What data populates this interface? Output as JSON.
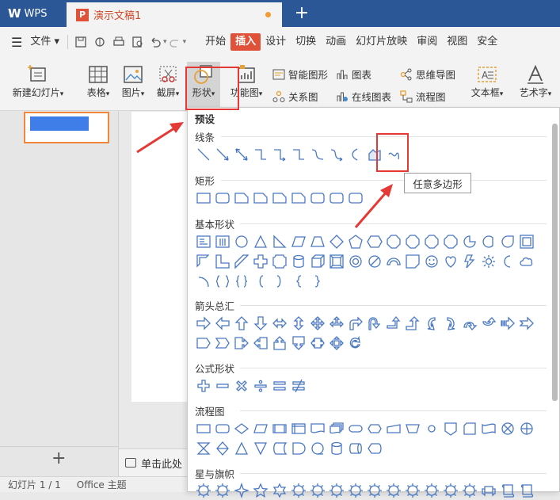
{
  "titlebar": {
    "app_name": "WPS",
    "doc_name": "演示文稿1",
    "new_tab": "+"
  },
  "menu": {
    "file": "文件",
    "items": [
      "开始",
      "插入",
      "设计",
      "切换",
      "动画",
      "幻灯片放映",
      "审阅",
      "视图",
      "安全"
    ],
    "active": "插入"
  },
  "ribbon": {
    "new_slide": "新建幻灯片",
    "table": "表格",
    "picture": "图片",
    "screenshot": "截屏",
    "shapes": "形状",
    "function_chart": "功能图",
    "smart_art": "智能图形",
    "chart": "图表",
    "mind_map": "思维导图",
    "relation": "关系图",
    "online_chart": "在线图表",
    "flowchart": "流程图",
    "textbox": "文本框",
    "wordart": "艺术字"
  },
  "dropdown": {
    "preset": "预设",
    "sections": {
      "lines": "线条",
      "rect": "矩形",
      "basic": "基本形状",
      "arrows": "箭头总汇",
      "equation": "公式形状",
      "flow": "流程图",
      "stars": "星与旗帜"
    }
  },
  "tooltip": "任意多边形",
  "notes_text": "单击此处",
  "status": {
    "slide": "幻灯片 1 / 1",
    "theme": "Office 主题"
  },
  "colors": {
    "title_bg": "#2b5797",
    "accent": "#e0513a",
    "shape_stroke": "#4a78c2",
    "highlight": "#e53935"
  }
}
